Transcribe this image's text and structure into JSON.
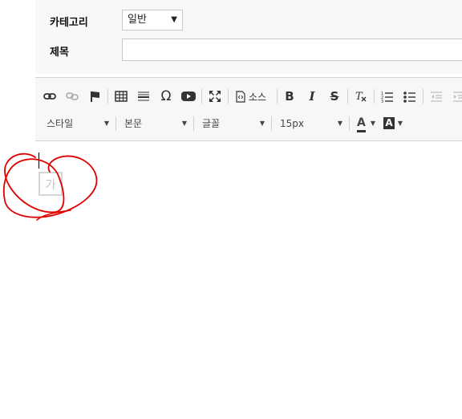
{
  "form": {
    "category_label": "카테고리",
    "category_value": "일반",
    "title_label": "제목",
    "title_value": ""
  },
  "toolbar": {
    "row1": [
      {
        "name": "link-icon"
      },
      {
        "name": "unlink-icon"
      },
      {
        "name": "anchor-flag-icon"
      },
      {
        "name": "table-icon"
      },
      {
        "name": "horizontal-line-icon"
      },
      {
        "name": "special-char-icon",
        "glyph": "Ω"
      },
      {
        "name": "youtube-icon"
      },
      {
        "name": "maximize-icon"
      },
      {
        "name": "source-icon",
        "label": "소스"
      },
      {
        "name": "bold-icon",
        "glyph": "B"
      },
      {
        "name": "italic-icon",
        "glyph": "I"
      },
      {
        "name": "strike-icon",
        "glyph": "S"
      },
      {
        "name": "remove-format-icon",
        "glyph": "Tx"
      },
      {
        "name": "numbered-list-icon"
      },
      {
        "name": "bulleted-list-icon"
      },
      {
        "name": "outdent-icon"
      }
    ],
    "style_combo": "스타일",
    "format_combo": "본문",
    "font_combo": "글꼴",
    "size_combo": "15px",
    "text_color_glyph": "A",
    "bg_color_glyph": "A"
  },
  "editor": {
    "placeholder_char": "가"
  },
  "colors": {
    "annotation": "#e00000",
    "toolbar_bg": "#f7f7f7",
    "form_bg": "#f8f8f8"
  }
}
